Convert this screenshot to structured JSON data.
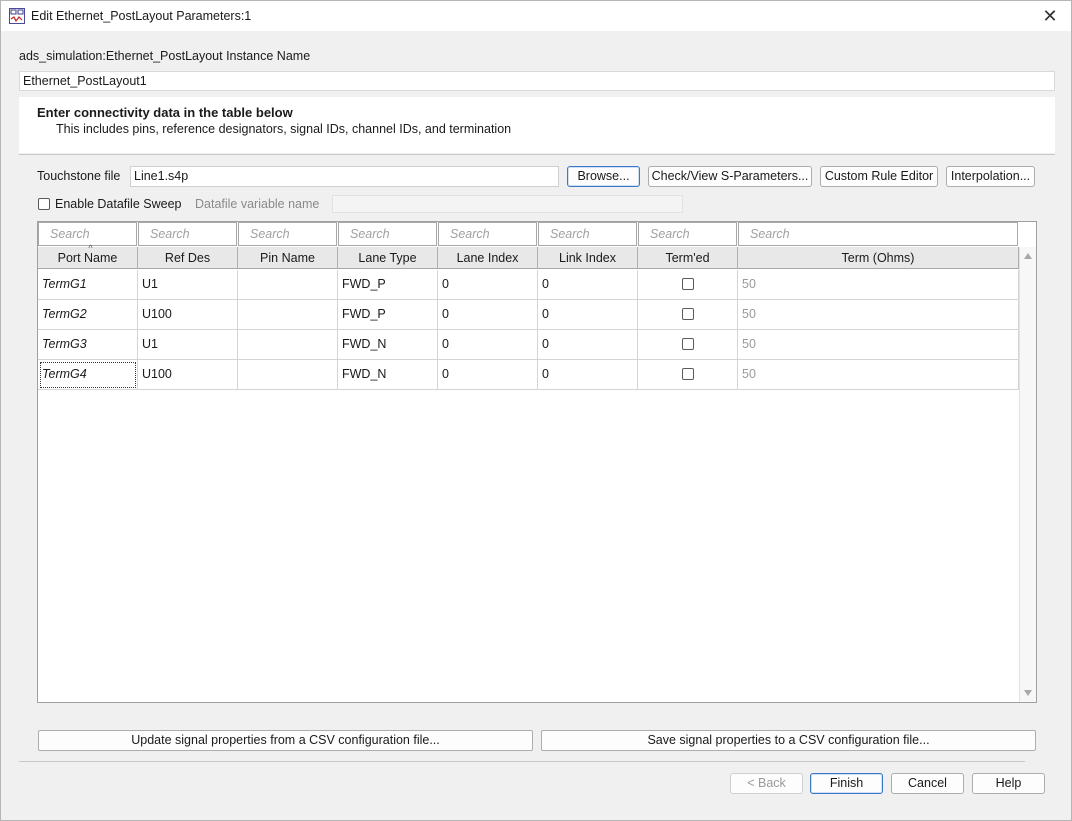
{
  "window": {
    "title": "Edit Ethernet_PostLayout Parameters:1",
    "close_glyph": "✕"
  },
  "instance": {
    "label": "ads_simulation:Ethernet_PostLayout Instance Name",
    "value": "Ethernet_PostLayout1"
  },
  "info": {
    "title": "Enter connectivity data in the table below",
    "subtitle": "This includes pins, reference designators, signal IDs, channel IDs, and termination"
  },
  "touchstone": {
    "label": "Touchstone file",
    "value": "Line1.s4p",
    "browse_label": "Browse...",
    "check_view_label": "Check/View S-Parameters...",
    "custom_rule_label": "Custom Rule Editor",
    "interpolation_label": "Interpolation..."
  },
  "sweep": {
    "enable_label": "Enable Datafile Sweep",
    "enabled": false,
    "variable_label": "Datafile variable name",
    "variable_value": ""
  },
  "table": {
    "search_placeholder": "Search",
    "columns": [
      "Port Name",
      "Ref Des",
      "Pin Name",
      "Lane Type",
      "Lane Index",
      "Link Index",
      "Term'ed",
      "Term (Ohms)"
    ],
    "sort_indicator": "^",
    "rows": [
      {
        "port": "TermG1",
        "ref": "U1",
        "pin": "",
        "lane_type": "FWD_P",
        "lane_index": "0",
        "link_index": "0",
        "termed": false,
        "term": "50"
      },
      {
        "port": "TermG2",
        "ref": "U100",
        "pin": "",
        "lane_type": "FWD_P",
        "lane_index": "0",
        "link_index": "0",
        "termed": false,
        "term": "50"
      },
      {
        "port": "TermG3",
        "ref": "U1",
        "pin": "",
        "lane_type": "FWD_N",
        "lane_index": "0",
        "link_index": "0",
        "termed": false,
        "term": "50"
      },
      {
        "port": "TermG4",
        "ref": "U100",
        "pin": "",
        "lane_type": "FWD_N",
        "lane_index": "0",
        "link_index": "0",
        "termed": false,
        "term": "50"
      }
    ]
  },
  "csv": {
    "update_label": "Update signal properties from a CSV configuration file...",
    "save_label": "Save signal properties to a CSV configuration file..."
  },
  "footer": {
    "back_label": "< Back",
    "finish_label": "Finish",
    "cancel_label": "Cancel",
    "help_label": "Help"
  }
}
